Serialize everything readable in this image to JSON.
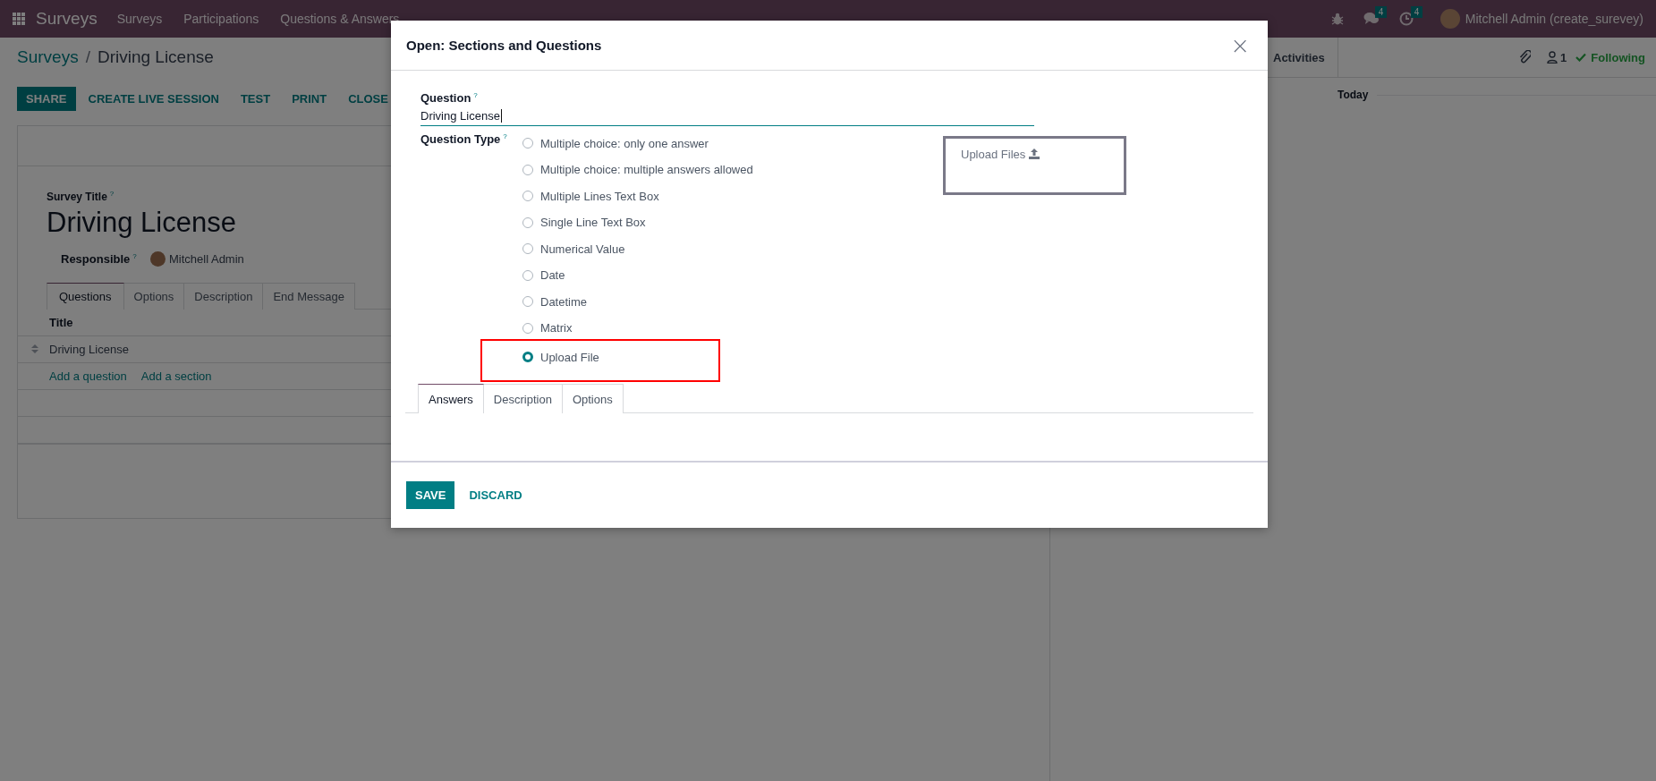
{
  "navbar": {
    "app_name": "Surveys",
    "menu": [
      {
        "label": "Surveys"
      },
      {
        "label": "Participations"
      },
      {
        "label": "Questions & Answers"
      }
    ],
    "messages_badge": "4",
    "activities_badge": "4",
    "user": "Mitchell Admin (create_surevey)"
  },
  "breadcrumb": {
    "items": [
      {
        "label": "Surveys"
      },
      {
        "label": "Driving License"
      }
    ],
    "separator": "/"
  },
  "action_buttons": [
    {
      "label": "SHARE",
      "kind": "primary"
    },
    {
      "label": "CREATE LIVE SESSION",
      "kind": "link"
    },
    {
      "label": "TEST",
      "kind": "link"
    },
    {
      "label": "PRINT",
      "kind": "link"
    },
    {
      "label": "CLOSE",
      "kind": "link"
    }
  ],
  "form": {
    "title_label": "Survey Title",
    "title_help": "?",
    "title": "Driving License",
    "responsible_label": "Responsible",
    "responsible_help": "?",
    "responsible": "Mitchell Admin",
    "tabs": [
      {
        "label": "Questions",
        "selected": true
      },
      {
        "label": "Options",
        "selected": false
      },
      {
        "label": "Description",
        "selected": false
      },
      {
        "label": "End Message",
        "selected": false
      }
    ],
    "list": {
      "column": "Title",
      "rows": [
        {
          "title": "Driving License"
        }
      ],
      "add_links": [
        "Add a question",
        "Add a section"
      ]
    }
  },
  "chatter": {
    "activities": "Activities",
    "followers_count": "1",
    "following": "Following",
    "date_separator": "Today"
  },
  "dialog": {
    "title": "Open: Sections and Questions",
    "close": "×",
    "question_label": "Question",
    "question_help": "?",
    "question_value": "Driving License",
    "type_label": "Question Type",
    "type_help": "?",
    "types": [
      {
        "label": "Multiple choice: only one answer",
        "selected": false
      },
      {
        "label": "Multiple choice: multiple answers allowed",
        "selected": false
      },
      {
        "label": "Multiple Lines Text Box",
        "selected": false
      },
      {
        "label": "Single Line Text Box",
        "selected": false
      },
      {
        "label": "Numerical Value",
        "selected": false
      },
      {
        "label": "Date",
        "selected": false
      },
      {
        "label": "Datetime",
        "selected": false
      },
      {
        "label": "Matrix",
        "selected": false
      },
      {
        "label": "Upload File",
        "selected": true
      }
    ],
    "upload_preview": "Upload Files",
    "tabs": [
      {
        "label": "Answers",
        "selected": true
      },
      {
        "label": "Description",
        "selected": false
      },
      {
        "label": "Options",
        "selected": false
      }
    ],
    "buttons": [
      {
        "label": "SAVE",
        "kind": "primary"
      },
      {
        "label": "DISCARD",
        "kind": "link"
      }
    ]
  }
}
